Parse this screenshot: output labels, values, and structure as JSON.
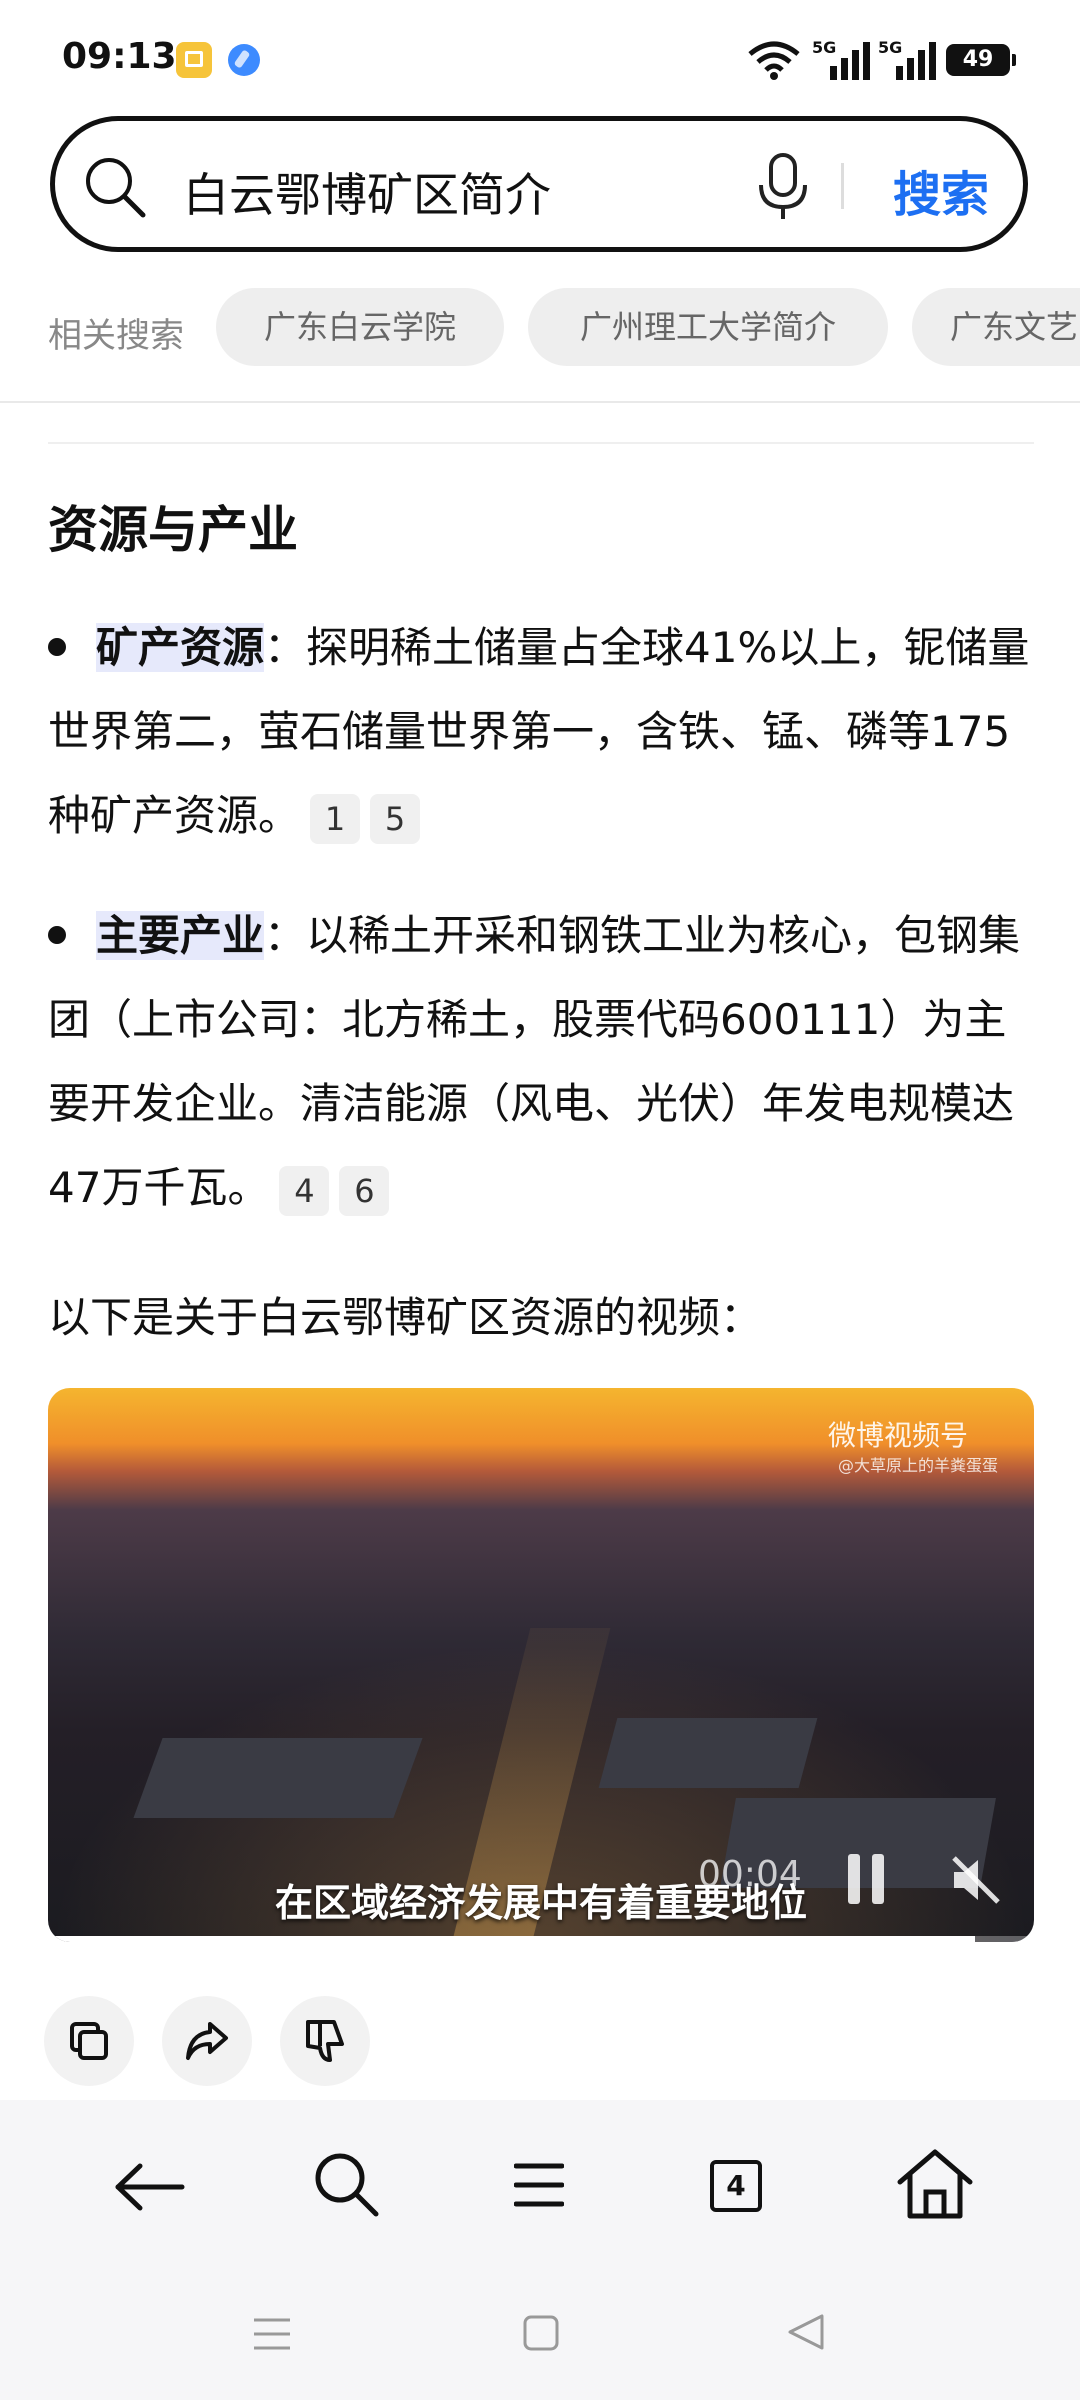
{
  "status_bar": {
    "time": "09:13",
    "network1": "5G",
    "network2": "5G",
    "battery": "49"
  },
  "search": {
    "query": "白云鄂博矿区简介",
    "button_label": "搜索"
  },
  "related": {
    "label": "相关搜索",
    "chips": [
      "广东白云学院",
      "广州理工大学简介",
      "广东文艺"
    ]
  },
  "content": {
    "section_title": "资源与产业",
    "bullet1": {
      "term": "矿产资源",
      "text": "：探明稀土储量占全球41%以上，铌储量世界第二，萤石储量世界第一，含铁、锰、磷等175种矿产资源。",
      "cites": [
        "1",
        "5"
      ]
    },
    "bullet2": {
      "term": "主要产业",
      "text": "：以稀土开采和钢铁工业为核心，包钢集团（上市公司：北方稀土，股票代码600111）为主要开发企业。清洁能源（风电、光伏）年发电规模达47万千瓦。",
      "cites": [
        "4",
        "6"
      ]
    },
    "video_intro": "以下是关于白云鄂博矿区资源的视频："
  },
  "video": {
    "watermark": "微博视频号",
    "watermark_sub": "@大草原上的羊粪蛋蛋",
    "caption": "在区域经济发展中有着重要地位",
    "time": "00:04",
    "progress_fraction": 0.94
  },
  "toolbar": {
    "tabs_count": "4"
  },
  "icons": {
    "search": "search-icon",
    "mic": "microphone-icon",
    "copy": "copy-icon",
    "share": "share-icon",
    "dislike": "thumbs-down-icon",
    "back": "back-arrow-icon",
    "menu": "menu-icon",
    "home": "home-icon"
  },
  "colors": {
    "accent": "#1d6ff2",
    "term_highlight": "#e6e9fb"
  }
}
